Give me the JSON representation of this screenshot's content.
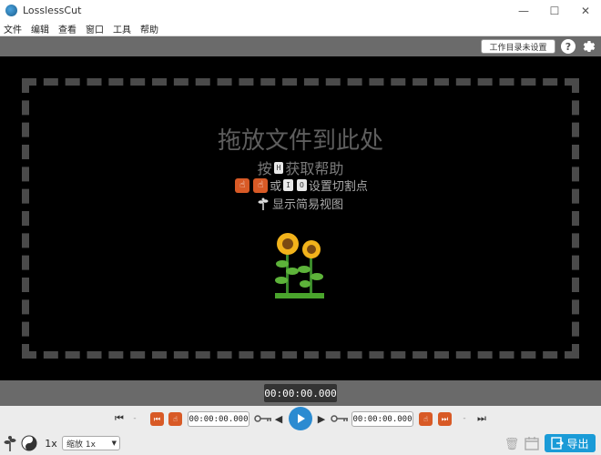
{
  "window": {
    "title": "LosslessCut",
    "minimize": "—",
    "maximize": "☐",
    "close": "✕"
  },
  "menu": [
    "文件",
    "编辑",
    "查看",
    "窗口",
    "工具",
    "帮助"
  ],
  "toolbar": {
    "workdir_label": "工作目录未设置",
    "help_label": "?"
  },
  "drop": {
    "title": "拖放文件到此处",
    "help_prefix": "按",
    "help_key": "H",
    "help_suffix": "获取帮助",
    "or_text": "或",
    "key_i": "I",
    "key_o": "O",
    "cut_suffix": "设置切割点",
    "easy_mode_text": "显示简易视图"
  },
  "timeline": {
    "current_time": "00:00:00.000"
  },
  "controls": {
    "cut_start_time": "00:00:00.000",
    "cut_end_time": "00:00:00.000",
    "dash": "-",
    "playback_rate": "1x",
    "zoom_value": "缩放 1x",
    "export_label": "导出"
  },
  "colors": {
    "accent": "#1a9bd7",
    "cut_orange": "#d85a26",
    "dash": "#4a4a4a"
  }
}
